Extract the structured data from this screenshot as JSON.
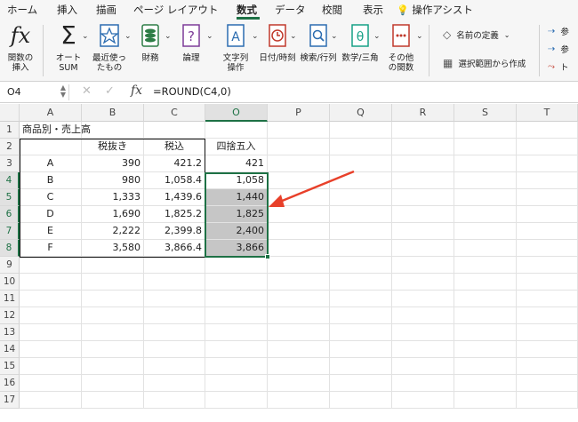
{
  "tabs": [
    "ホーム",
    "挿入",
    "描画",
    "ページ レイアウト",
    "数式",
    "データ",
    "校閲",
    "表示",
    "操作アシスト"
  ],
  "active_tab_index": 4,
  "ribbon": {
    "insert_function": "関数の\n挿入",
    "autosum": "オート\nSUM",
    "recent": "最近使っ\nたもの",
    "financial": "財務",
    "logical": "論理",
    "text": "文字列\n操作",
    "datetime": "日付/時刻",
    "lookup": "検索/行列",
    "math": "数学/三角",
    "more": "その他\nの関数",
    "define_name": "名前の定義",
    "create_from_selection": "選択範囲から作成",
    "trace_prec": "参",
    "trace_dep": "参",
    "remove_arrows": "ト"
  },
  "formula_bar": {
    "name_box": "O4",
    "fx": "fx",
    "formula": "=ROUND(C4,0)"
  },
  "columns": [
    "A",
    "B",
    "C",
    "O",
    "P",
    "Q",
    "R",
    "S",
    "T"
  ],
  "selected_column": "O",
  "rows": [
    "1",
    "2",
    "3",
    "4",
    "5",
    "6",
    "7",
    "8",
    "9",
    "10",
    "11",
    "12",
    "13",
    "14",
    "15",
    "16",
    "17"
  ],
  "selected_rows": [
    "4",
    "5",
    "6",
    "7",
    "8"
  ],
  "sheet": {
    "title": "商品別・売上高",
    "header": {
      "B": "税抜き",
      "C": "税込",
      "O": "四捨五入"
    },
    "data": [
      {
        "A": "A",
        "B": "390",
        "C": "421.2",
        "O": "421"
      },
      {
        "A": "B",
        "B": "980",
        "C": "1,058.4",
        "O": "1,058"
      },
      {
        "A": "C",
        "B": "1,333",
        "C": "1,439.6",
        "O": "1,440"
      },
      {
        "A": "D",
        "B": "1,690",
        "C": "1,825.2",
        "O": "1,825"
      },
      {
        "A": "E",
        "B": "2,222",
        "C": "2,399.8",
        "O": "2,400"
      },
      {
        "A": "F",
        "B": "3,580",
        "C": "3,866.4",
        "O": "3,866"
      }
    ]
  },
  "colors": {
    "accent": "#1e7145",
    "arrow": "#e8402a",
    "highlight": "#c6c6c6"
  }
}
